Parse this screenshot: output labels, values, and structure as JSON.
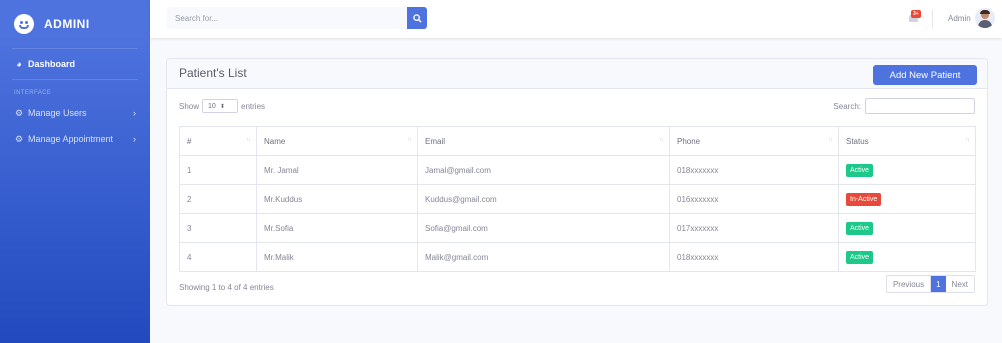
{
  "brand": {
    "name": "ADMINI",
    "icon": "laugh-icon"
  },
  "sidebar": {
    "heading": "INTERFACE",
    "items": [
      {
        "label": "Dashboard",
        "icon": "dashboard-icon"
      },
      {
        "label": "Manage Users",
        "icon": "gear-icon",
        "chevron": "›"
      },
      {
        "label": "Manage Appointment",
        "icon": "gear-icon",
        "chevron": "›"
      }
    ]
  },
  "topbar": {
    "search_placeholder": "Search for...",
    "alert_count": "3+",
    "user_name": "Admin"
  },
  "card": {
    "title": "Patient's List",
    "add_button": "Add New Patient",
    "show_label": "Show",
    "entries_value": "10",
    "entries_label": "entries",
    "search_label": "Search:",
    "columns": [
      "#",
      "Name",
      "Email",
      "Phone",
      "Status"
    ],
    "rows": [
      {
        "num": "1",
        "name": "Mr. Jamal",
        "email": "Jamal@gmail.com",
        "phone": "018xxxxxxx",
        "status": "Active"
      },
      {
        "num": "2",
        "name": "Mr.Kuddus",
        "email": "Kuddus@gmail.com",
        "phone": "016xxxxxxx",
        "status": "In-Active"
      },
      {
        "num": "3",
        "name": "Mr.Sofia",
        "email": "Sofia@gmail.com",
        "phone": "017xxxxxxx",
        "status": "Active"
      },
      {
        "num": "4",
        "name": "Mr.Malik",
        "email": "Malik@gmail.com",
        "phone": "018xxxxxxx",
        "status": "Active"
      }
    ],
    "info": "Showing 1 to 4 of 4 entries",
    "pager": {
      "previous": "Previous",
      "current": "1",
      "next": "Next"
    }
  },
  "colors": {
    "primary": "#4e73df",
    "success": "#1cc88a",
    "danger": "#e74a3b"
  }
}
